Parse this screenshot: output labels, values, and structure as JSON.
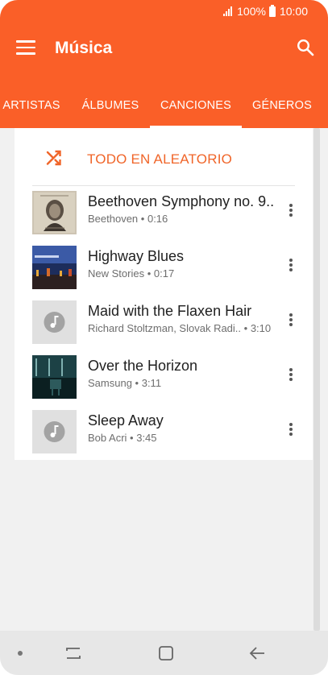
{
  "status_bar": {
    "battery": "100%",
    "time": "10:00"
  },
  "app_bar": {
    "title": "Música",
    "tabs": [
      {
        "label": "ARTISTAS"
      },
      {
        "label": "ÁLBUMES"
      },
      {
        "label": "CANCIONES"
      },
      {
        "label": "GÉNEROS"
      }
    ],
    "active_tab": "CANCIONES"
  },
  "shuffle": {
    "label": "TODO EN ALEATORIO"
  },
  "songs": [
    {
      "title": "Beethoven Symphony no. 9..",
      "artist": "Beethoven",
      "duration": "0:16",
      "art": "beethoven-portrait"
    },
    {
      "title": "Highway Blues",
      "artist": "New Stories",
      "duration": "0:17",
      "art": "night-city"
    },
    {
      "title": "Maid with the Flaxen Hair",
      "artist": "Richard Stoltzman, Slovak Radi..",
      "duration": "3:10",
      "art": "placeholder"
    },
    {
      "title": "Over the Horizon",
      "artist": "Samsung",
      "duration": "3:11",
      "art": "horizon-room"
    },
    {
      "title": "Sleep Away",
      "artist": "Bob Acri",
      "duration": "3:45",
      "art": "placeholder"
    }
  ],
  "colors": {
    "brand": "#fa5f28",
    "shuffle_text": "#f06529"
  },
  "icons": {
    "menu": "hamburger-icon",
    "search": "search-icon",
    "shuffle": "shuffle-icon",
    "more": "more-vertical-icon",
    "music_note": "music-note-icon"
  }
}
